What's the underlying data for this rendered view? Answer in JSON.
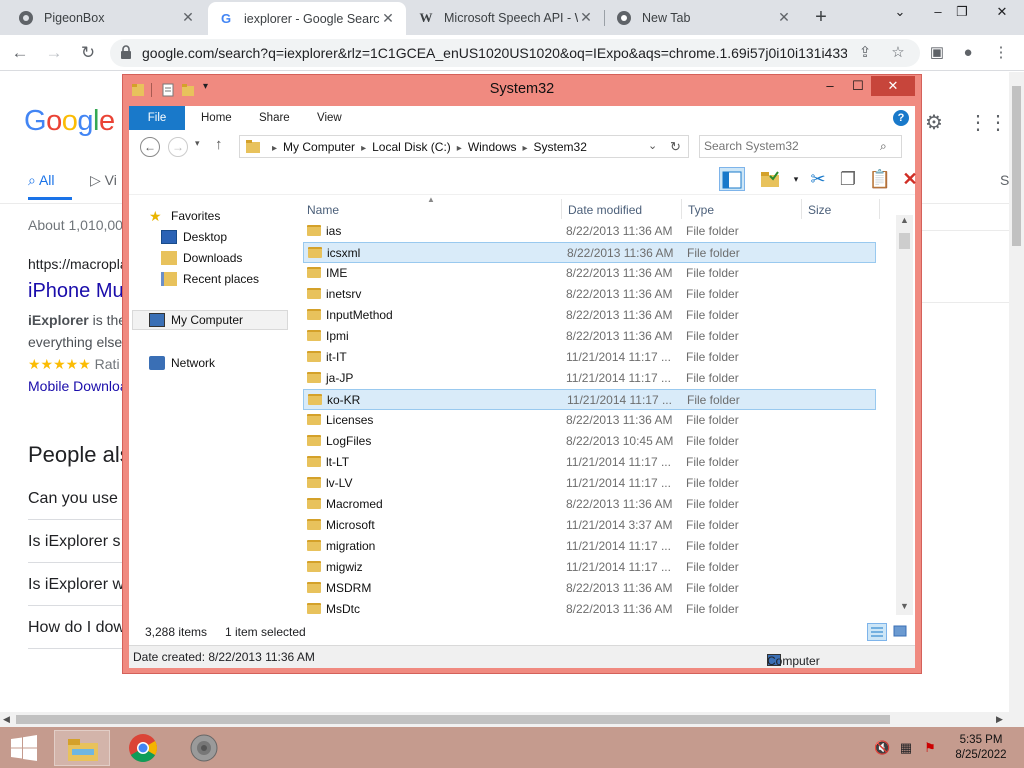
{
  "browser": {
    "tabs": [
      {
        "label": "PigeonBox",
        "icon": "pigeonbox-icon"
      },
      {
        "label": "iexplorer - Google Search",
        "icon": "google-icon"
      },
      {
        "label": "Microsoft Speech API - W",
        "icon": "wikipedia-icon"
      },
      {
        "label": "New Tab",
        "icon": "chrome-icon"
      }
    ],
    "url": "google.com/search?q=iexplorer&rlz=1C1GCEA_enUS1020US1020&oq=IExpo&aqs=chrome.1.69i57j0i10i131i433..."
  },
  "google": {
    "logo": "Google",
    "tabs": [
      "All",
      "Vi",
      "S"
    ],
    "about": "About 1,010,00",
    "result_url": "https://macropla",
    "result_title": "iPhone Mu",
    "snippet_bold": "iExplorer",
    "snippet_rest": " is the",
    "snippet_line2": "everything else",
    "rating_stars": "★★★★★",
    "rating_text": "Rati",
    "mobile_link": "Mobile Downloa",
    "people_also": "People als",
    "questions": [
      "Can you use",
      "Is iExplorer s",
      "Is iExplorer w",
      "How do I dow"
    ]
  },
  "explorer": {
    "title": "System32",
    "ribbon_tabs": [
      "File",
      "Home",
      "Share",
      "View"
    ],
    "help": "?",
    "breadcrumb": [
      "My Computer",
      "Local Disk (C:)",
      "Windows",
      "System32"
    ],
    "search_placeholder": "Search System32",
    "nav": {
      "favorites": "Favorites",
      "desktop": "Desktop",
      "downloads": "Downloads",
      "recent": "Recent places",
      "mycomputer": "My Computer",
      "network": "Network"
    },
    "columns": {
      "name": "Name",
      "date": "Date modified",
      "type": "Type",
      "size": "Size"
    },
    "files": [
      {
        "name": "ias",
        "date": "8/22/2013 11:36 AM",
        "type": "File folder"
      },
      {
        "name": "icsxml",
        "date": "8/22/2013 11:36 AM",
        "type": "File folder"
      },
      {
        "name": "IME",
        "date": "8/22/2013 11:36 AM",
        "type": "File folder"
      },
      {
        "name": "inetsrv",
        "date": "8/22/2013 11:36 AM",
        "type": "File folder"
      },
      {
        "name": "InputMethod",
        "date": "8/22/2013 11:36 AM",
        "type": "File folder"
      },
      {
        "name": "Ipmi",
        "date": "8/22/2013 11:36 AM",
        "type": "File folder"
      },
      {
        "name": "it-IT",
        "date": "11/21/2014 11:17 ...",
        "type": "File folder"
      },
      {
        "name": "ja-JP",
        "date": "11/21/2014 11:17 ...",
        "type": "File folder"
      },
      {
        "name": "ko-KR",
        "date": "11/21/2014 11:17 ...",
        "type": "File folder"
      },
      {
        "name": "Licenses",
        "date": "8/22/2013 11:36 AM",
        "type": "File folder"
      },
      {
        "name": "LogFiles",
        "date": "8/22/2013 10:45 AM",
        "type": "File folder"
      },
      {
        "name": "lt-LT",
        "date": "11/21/2014 11:17 ...",
        "type": "File folder"
      },
      {
        "name": "lv-LV",
        "date": "11/21/2014 11:17 ...",
        "type": "File folder"
      },
      {
        "name": "Macromed",
        "date": "8/22/2013 11:36 AM",
        "type": "File folder"
      },
      {
        "name": "Microsoft",
        "date": "11/21/2014 3:37 AM",
        "type": "File folder"
      },
      {
        "name": "migration",
        "date": "11/21/2014 11:17 ...",
        "type": "File folder"
      },
      {
        "name": "migwiz",
        "date": "11/21/2014 11:17 ...",
        "type": "File folder"
      },
      {
        "name": "MSDRM",
        "date": "8/22/2013 11:36 AM",
        "type": "File folder"
      },
      {
        "name": "MsDtc",
        "date": "8/22/2013 11:36 AM",
        "type": "File folder"
      }
    ],
    "status_count": "3,288 items",
    "status_selected": "1 item selected",
    "details_date": "Date created: 8/22/2013 11:36 AM",
    "details_location": "Computer"
  },
  "taskbar": {
    "time": "5:35 PM",
    "date": "8/25/2022"
  }
}
